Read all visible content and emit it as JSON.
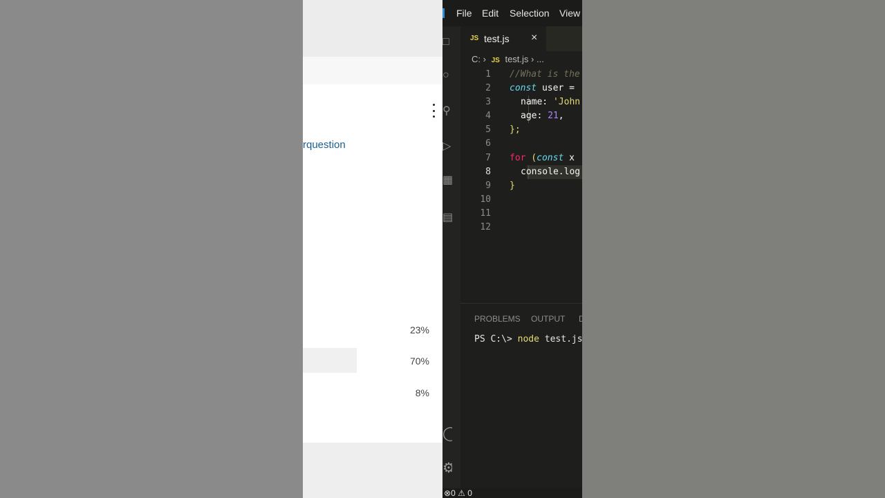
{
  "poll": {
    "link_text": "rquestion",
    "options": [
      {
        "percent": "23%",
        "value": 23
      },
      {
        "percent": "70%",
        "value": 70
      },
      {
        "percent": "8%",
        "value": 8
      }
    ]
  },
  "menu": {
    "items": [
      "File",
      "Edit",
      "Selection",
      "View"
    ]
  },
  "editor": {
    "tab_label": "test.js",
    "tab_close": "×",
    "file_badge": "JS",
    "breadcrumb": {
      "drive": "C:",
      "file": "test.js",
      "ellipsis": "..."
    },
    "lines": [
      {
        "num": "1",
        "code": "//What is the"
      },
      {
        "num": "2",
        "kw": "const",
        "rest": " user ="
      },
      {
        "num": "3",
        "prop": "name: ",
        "str": "'John"
      },
      {
        "num": "4",
        "prop": "age: ",
        "num_val": "21",
        "tail": ","
      },
      {
        "num": "5",
        "code": "};"
      },
      {
        "num": "6",
        "code": ""
      },
      {
        "num": "7",
        "kw2": "for",
        "open": " (",
        "kw": "const",
        "rest": " x"
      },
      {
        "num": "8",
        "code": "console.log"
      },
      {
        "num": "9",
        "code": "}"
      },
      {
        "num": "10",
        "code": ""
      },
      {
        "num": "11",
        "code": ""
      },
      {
        "num": "12",
        "code": ""
      }
    ]
  },
  "panel": {
    "tabs": [
      "PROBLEMS",
      "OUTPUT",
      "D"
    ],
    "prompt": "PS C:\\> ",
    "command": "node",
    "args": " test.js"
  },
  "status": {
    "errors": "0",
    "warnings": "0"
  },
  "colors": {
    "accent": "#2f8fd6",
    "js_badge": "#e8d44d",
    "link": "#1a5e92"
  }
}
